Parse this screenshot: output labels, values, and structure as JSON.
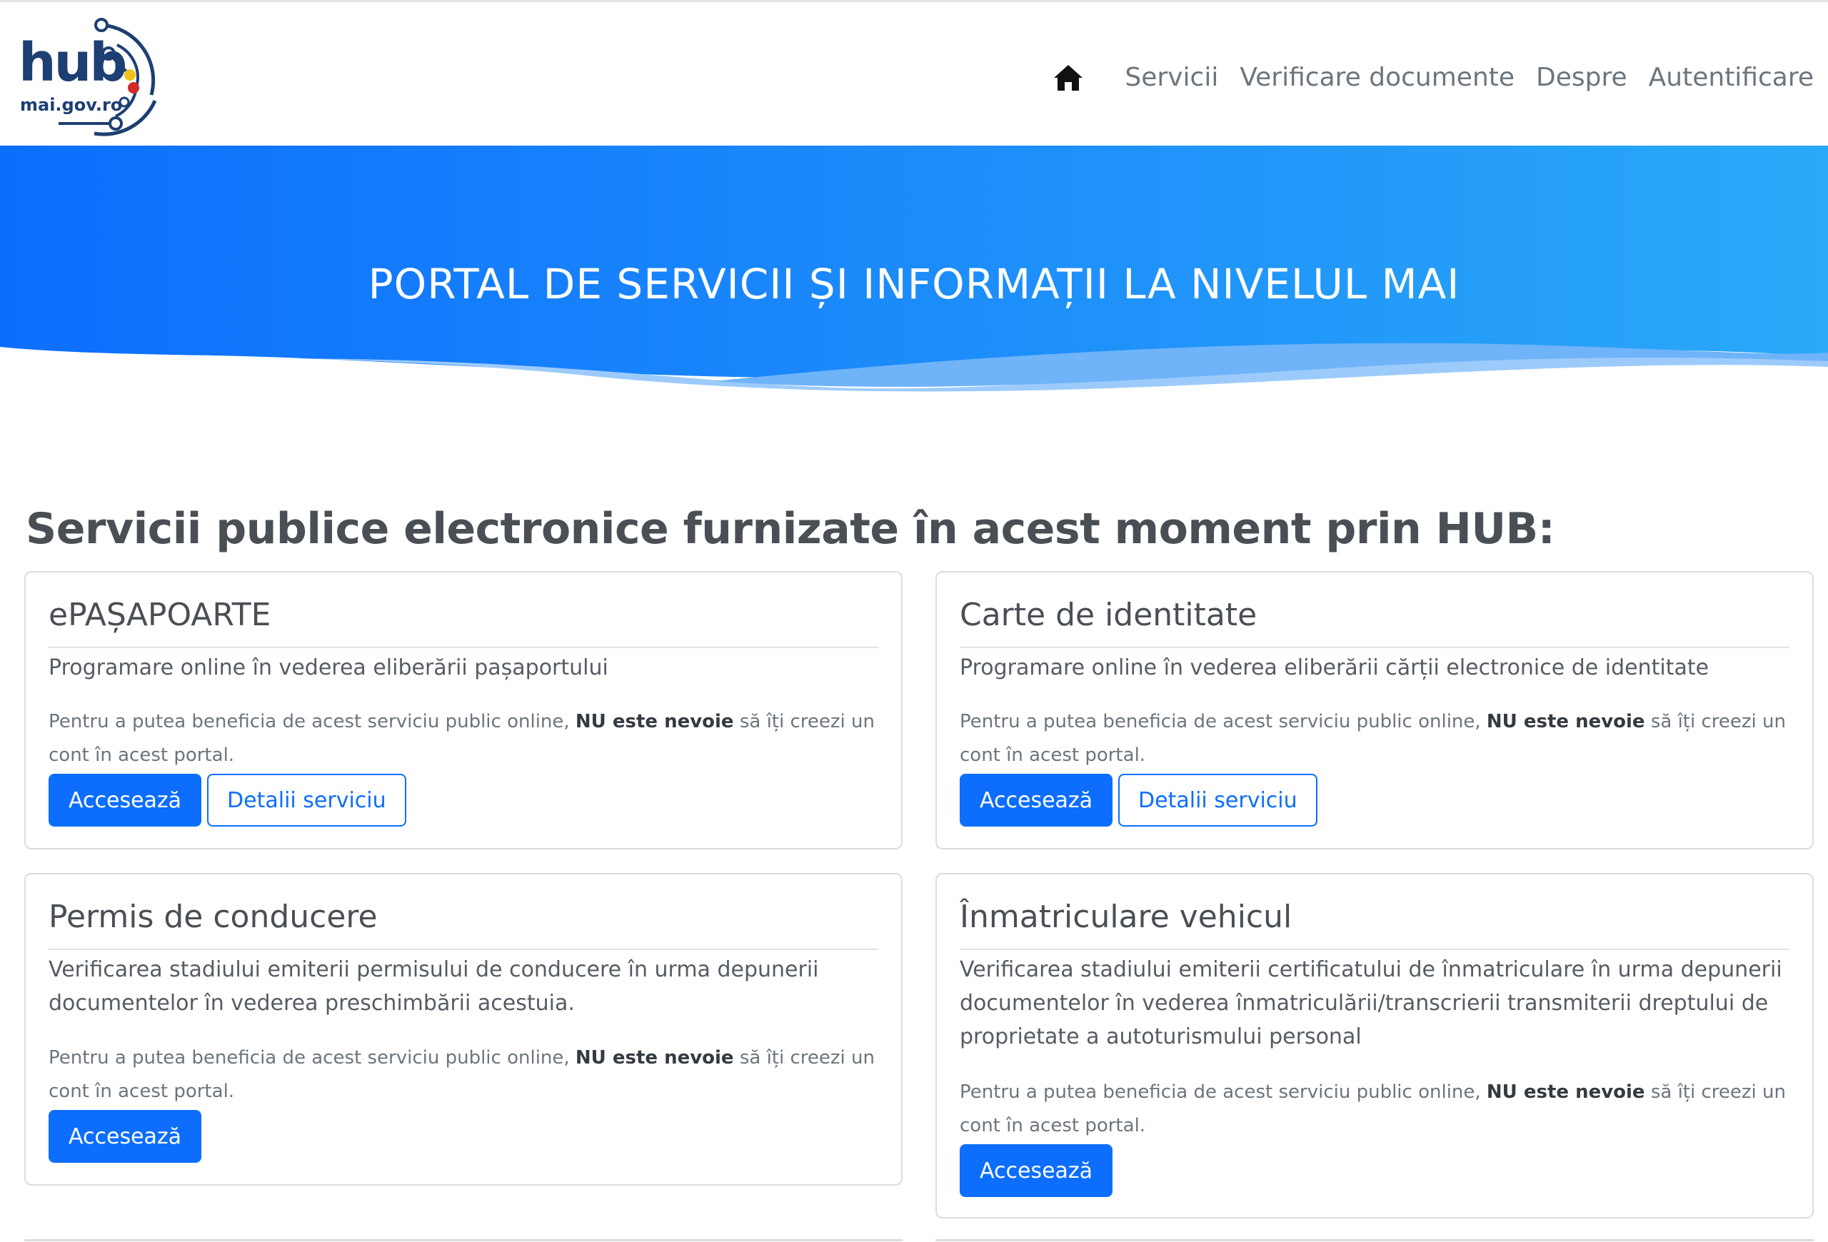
{
  "header": {
    "logo": {
      "word": "hub",
      "domain": "mai.gov.ro"
    },
    "nav": {
      "home_icon": "home-icon",
      "links": [
        "Servicii",
        "Verificare documente",
        "Despre",
        "Autentificare"
      ]
    }
  },
  "hero": {
    "title": "PORTAL DE SERVICII ȘI INFORMAȚII LA NIVELUL MAI"
  },
  "main": {
    "heading": "Servicii publice electronice furnizate în acest moment prin  HUB:",
    "note": {
      "before": "Pentru a putea beneficia de acest serviciu public online, ",
      "bold": "NU este nevoie",
      "after": " să îți creezi un cont în acest portal."
    },
    "cards": [
      {
        "title": "ePAȘAPOARTE",
        "description": "Programare online în vederea eliberării pașaportului",
        "primary_label": "Accesează",
        "secondary_label": "Detalii serviciu"
      },
      {
        "title": "Carte de identitate",
        "description": "Programare online în vederea eliberării cărții electronice de identitate",
        "primary_label": "Accesează",
        "secondary_label": "Detalii serviciu"
      },
      {
        "title": "Permis de conducere",
        "description": "Verificarea stadiului emiterii permisului de conducere în urma depunerii documentelor în vederea preschimbării acestuia.",
        "primary_label": "Accesează"
      },
      {
        "title": "Înmatriculare vehicul",
        "description": "Verificarea stadiului emiterii certificatului de înmatriculare în urma depunerii documentelor în vederea înmatriculării/transcrierii transmiterii dreptului de proprietate a autoturismului personal",
        "primary_label": "Accesează"
      }
    ]
  },
  "colors": {
    "primary": "#0d6efd",
    "hero_start": "#0d6efd",
    "hero_end": "#2aa9f8",
    "logo_navy": "#1d3f72"
  }
}
